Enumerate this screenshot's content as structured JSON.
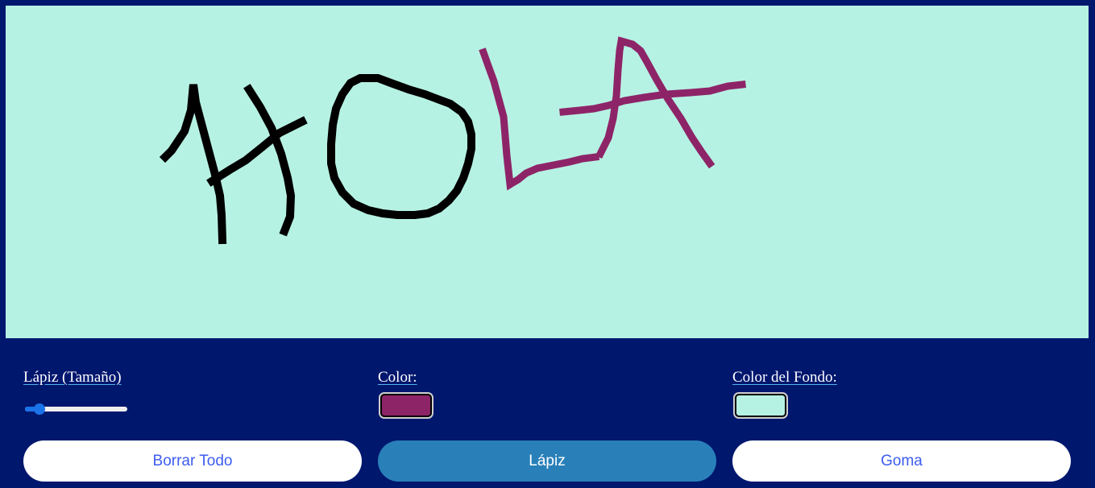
{
  "canvas": {
    "background_color": "#b6f2e3",
    "drawing_text": "HOLA",
    "strokes": [
      {
        "letter": "H",
        "color": "#000000"
      },
      {
        "letter": "O",
        "color": "#000000"
      },
      {
        "letter": "L",
        "color": "#8e2468"
      },
      {
        "letter": "A",
        "color": "#8e2468"
      }
    ]
  },
  "controls": {
    "pencil_size": {
      "label": "Lápiz (Tamaño)",
      "level_fraction": 0.1
    },
    "pen_color": {
      "label": "Color:",
      "value": "#8e2468"
    },
    "background_color": {
      "label": "Color del Fondo:",
      "value": "#b6f2e3"
    }
  },
  "buttons": {
    "clear_all": "Borrar Todo",
    "pencil": "Lápiz",
    "eraser": "Goma",
    "active": "pencil"
  },
  "colors": {
    "page_background": "#00176e",
    "button_active": "#2980b9",
    "button_text": "#3d5cf0"
  }
}
